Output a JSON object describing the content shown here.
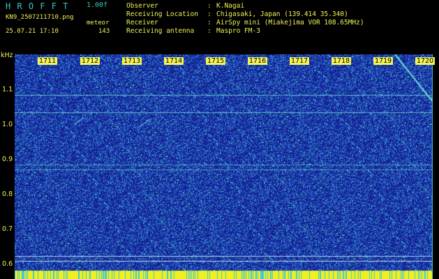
{
  "header": {
    "app_title": "HROFFT",
    "version": "1.00f",
    "filename": "KN9_2507211710.png",
    "datetime": "25.07.21 17:10",
    "meteor_label": "meteor",
    "meteor_count": "143"
  },
  "station_info": [
    {
      "label": "Observer",
      "value": "K.Nagai"
    },
    {
      "label": "Receiving Location",
      "value": "Chigasaki, Japan (139.414 35.340)"
    },
    {
      "label": "Receiver",
      "value": "AirSpy mini (Miakejima VOR 108.65MHz)"
    },
    {
      "label": "Receiving antenna",
      "value": "Maspro FM-3"
    }
  ],
  "spectrogram": {
    "y_unit": "kHz",
    "y_ticks": [
      "1.1",
      "1.0",
      "0.9",
      "0.8",
      "0.7",
      "0.6"
    ],
    "x_ticks": [
      "1711",
      "1712",
      "1713",
      "1714",
      "1715",
      "1716",
      "1717",
      "1718",
      "1719",
      "1720"
    ],
    "colors": {
      "background": "#10208a",
      "noise_low": "#2040c0",
      "noise_high": "#40d8d0",
      "trace": "#70e8d0",
      "bottom_bar": "#f0f020"
    }
  }
}
